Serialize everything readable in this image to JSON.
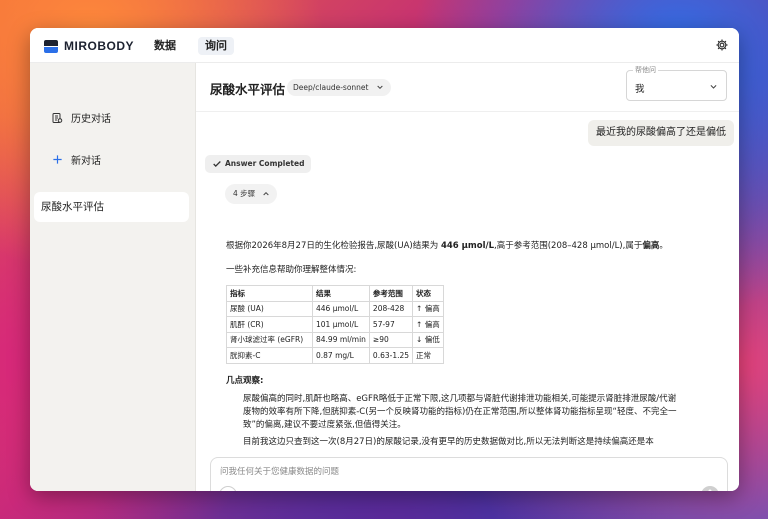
{
  "app": {
    "brand": "MIROBODY",
    "nav": [
      {
        "label": "数据"
      },
      {
        "label": "询问"
      }
    ]
  },
  "sidebar": {
    "history_label": "历史对话",
    "new_chat_label": "新对话",
    "conversations": [
      {
        "title": "尿酸水平评估"
      }
    ]
  },
  "header": {
    "title": "尿酸水平评估",
    "model": "Deep/claude-sonnet",
    "ask_for_label": "帮他问",
    "ask_for_value": "我"
  },
  "chat": {
    "user_message": "最近我的尿酸偏高了还是偏低",
    "status_badge": "Answer Completed",
    "steps_label": "4 步骤",
    "intro_before": "根据你2026年8月27日的生化检验报告,尿酸(UA)结果为 ",
    "intro_value": "446 µmol/L",
    "intro_middle": ",高于参考范围(208–428 µmol/L),属于",
    "intro_verdict": "偏高",
    "intro_end": "。",
    "supplement": "一些补充信息帮助你理解整体情况:",
    "table": {
      "headers": [
        "指标",
        "结果",
        "参考范围",
        "状态"
      ],
      "rows": [
        [
          "尿酸 (UA)",
          "446 µmol/L",
          "208-428",
          "↑ 偏高"
        ],
        [
          "肌酐 (CR)",
          "101 µmol/L",
          "57-97",
          "↑ 偏高"
        ],
        [
          "肾小球滤过率 (eGFR)",
          "84.99 ml/min",
          "≥90",
          "↓ 偏低"
        ],
        [
          "胱抑素-C",
          "0.87 mg/L",
          "0.63-1.25",
          "正常"
        ]
      ]
    },
    "observations_title": "几点观察:",
    "observation_1": "尿酸偏高的同时,肌酐也略高、eGFR略低于正常下限,这几项都与肾脏代谢排泄功能相关,可能提示肾脏排泄尿酸/代谢废物的效率有所下降,但胱抑素-C(另一个反映肾功能的指标)仍在正常范围,所以整体肾功能指标呈现“轻度、不完全一致”的偏离,建议不要过度紧张,但值得关注。",
    "observation_2": "目前我这边只查到这一次(8月27日)的尿酸记录,没有更早的历史数据做对比,所以无法判断这是持续偏高还是本"
  },
  "composer": {
    "placeholder": "问我任何关于您健康数据的问题"
  }
}
